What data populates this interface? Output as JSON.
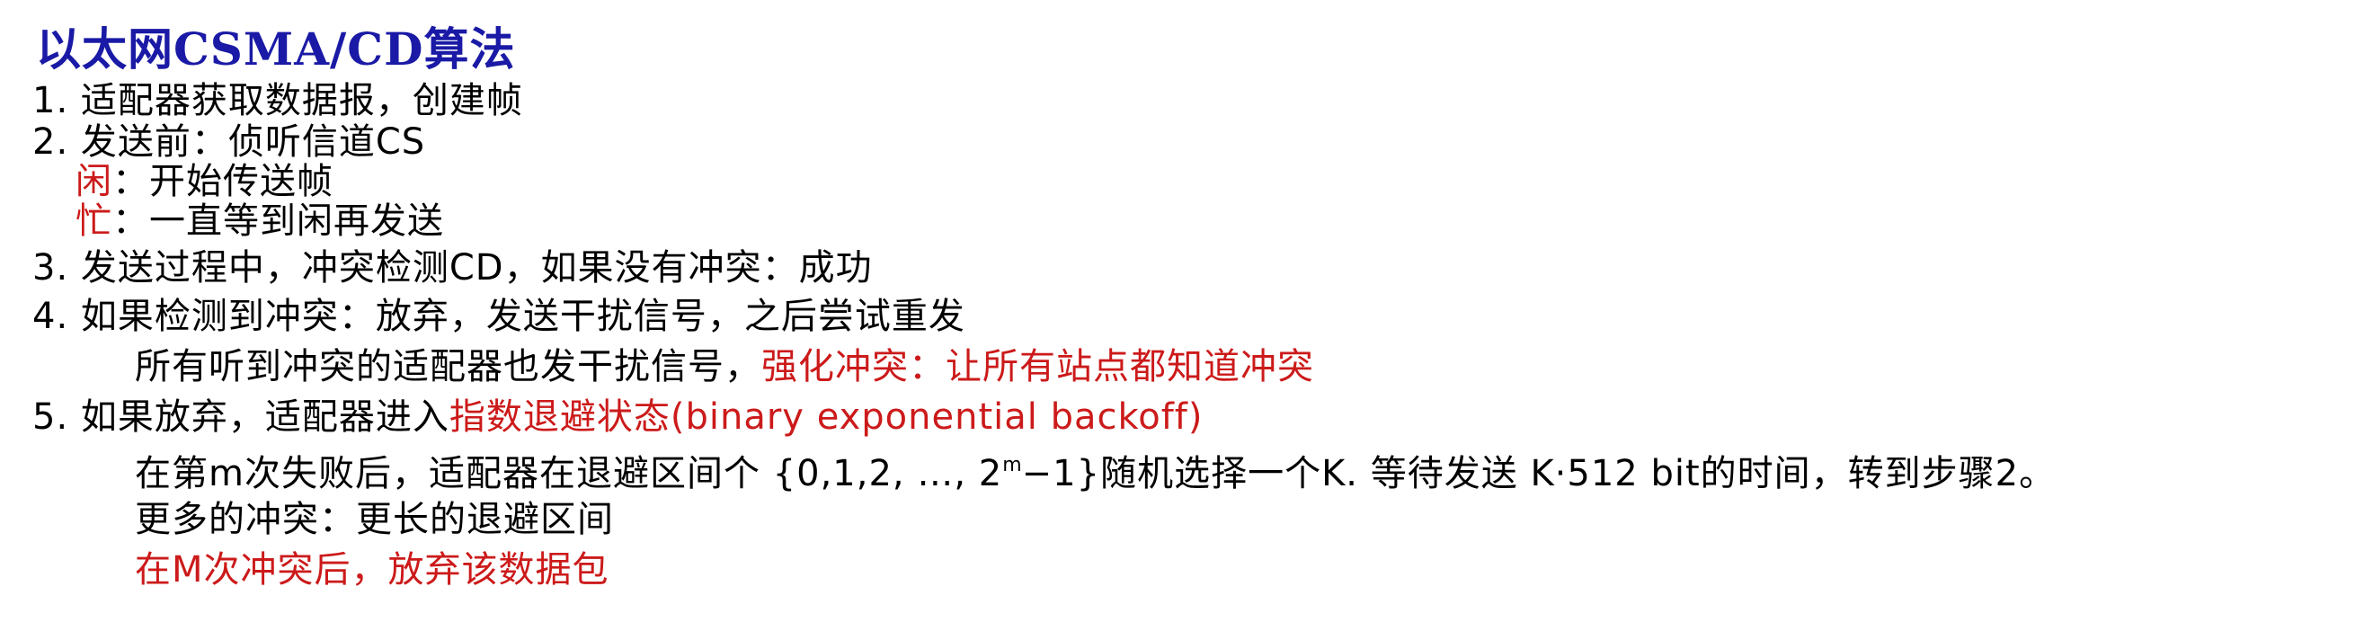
{
  "title": "以太网CSMA/CD算法",
  "step1": "1. 适配器获取数据报，创建帧",
  "step2": "2. 发送前：侦听信道CS",
  "idle": {
    "term": "闲",
    "rest": "：开始传送帧"
  },
  "busy": {
    "term": "忙",
    "rest": "：一直等到闲再发送"
  },
  "step3": "3. 发送过程中，冲突检测CD，如果没有冲突：成功",
  "step4": "4. 如果检测到冲突：放弃，发送干扰信号，之后尝试重发",
  "step4_detail": {
    "text": "所有听到冲突的适配器也发干扰信号，",
    "highlight": "强化冲突：让所有站点都知道冲突"
  },
  "step5": {
    "prefix": "5. 如果放弃，适配器进入",
    "highlight": "指数退避状态(binary exponential backoff)"
  },
  "step5_detail1": {
    "before": "在第m次失败后，适配器在退避区间个 {0,1,2, …, 2",
    "sup": "m",
    "after": "−1}随机选择一个K. 等待发送 K·512 bit的时间，转到步骤2。"
  },
  "step5_detail2": "更多的冲突：更长的退避区间",
  "step5_detail3": "在M次冲突后，放弃该数据包",
  "colors": {
    "title": "#1a1aa6",
    "highlight": "#cc1a1a",
    "body": "#000000"
  }
}
